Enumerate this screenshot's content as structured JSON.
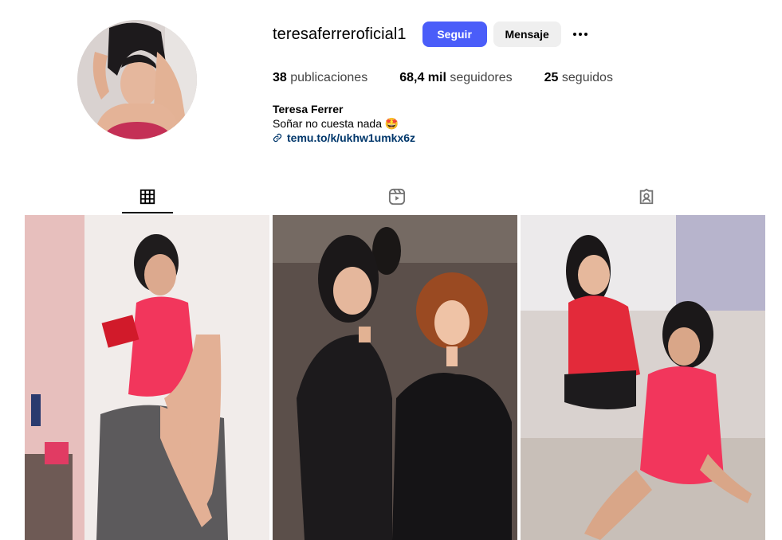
{
  "profile": {
    "username": "teresaferreroficial1",
    "follow_label": "Seguir",
    "message_label": "Mensaje",
    "more_icon": "more-options-icon",
    "avatar_icon": "profile-avatar"
  },
  "stats": {
    "posts_count": "38",
    "posts_label": "publicaciones",
    "followers_count": "68,4 mil",
    "followers_label": "seguidores",
    "following_count": "25",
    "following_label": "seguidos"
  },
  "bio": {
    "full_name": "Teresa Ferrer",
    "text": "Soñar no cuesta nada",
    "emoji": "🤩",
    "link": "temu.to/k/ukhw1umkx6z"
  },
  "tabs": [
    {
      "icon": "grid-icon",
      "active": true
    },
    {
      "icon": "reels-icon",
      "active": false
    },
    {
      "icon": "tagged-icon",
      "active": false
    }
  ],
  "colors": {
    "follow_button": "#4a5df9",
    "message_button": "#efefef",
    "link": "#00376b"
  }
}
